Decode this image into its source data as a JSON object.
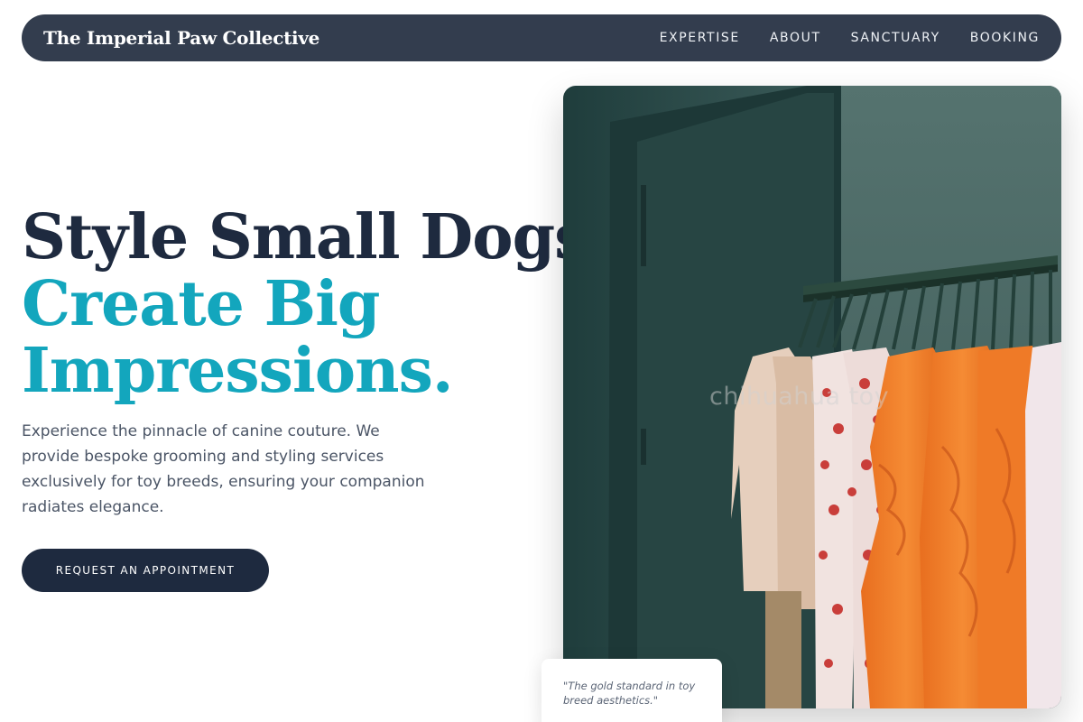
{
  "brand": {
    "name": "The Imperial Paw Collective"
  },
  "nav": {
    "links": [
      {
        "label": "EXPERTISE"
      },
      {
        "label": "ABOUT"
      },
      {
        "label": "SANCTUARY"
      },
      {
        "label": "BOOKING"
      }
    ]
  },
  "hero": {
    "headline_line1": "Style Small Dogs,",
    "headline_line2": "Create Big",
    "headline_line3": "Impressions.",
    "lead": "Experience the pinnacle of canine couture. We provide bespoke grooming and styling services exclusively for toy breeds, ensuring your companion radiates elegance.",
    "cta_label": "REQUEST AN APPOINTMENT"
  },
  "image": {
    "watermark": "chihuahua toy",
    "subject": "clothing-rack-photo"
  },
  "testimonial": {
    "quote": "\"The gold standard in toy breed aesthetics.\""
  },
  "colors": {
    "nav_bg": "#333d4e",
    "headline_dark": "#1e2a3f",
    "headline_accent": "#13a6bd",
    "cta_bg": "#1e2a3f"
  }
}
